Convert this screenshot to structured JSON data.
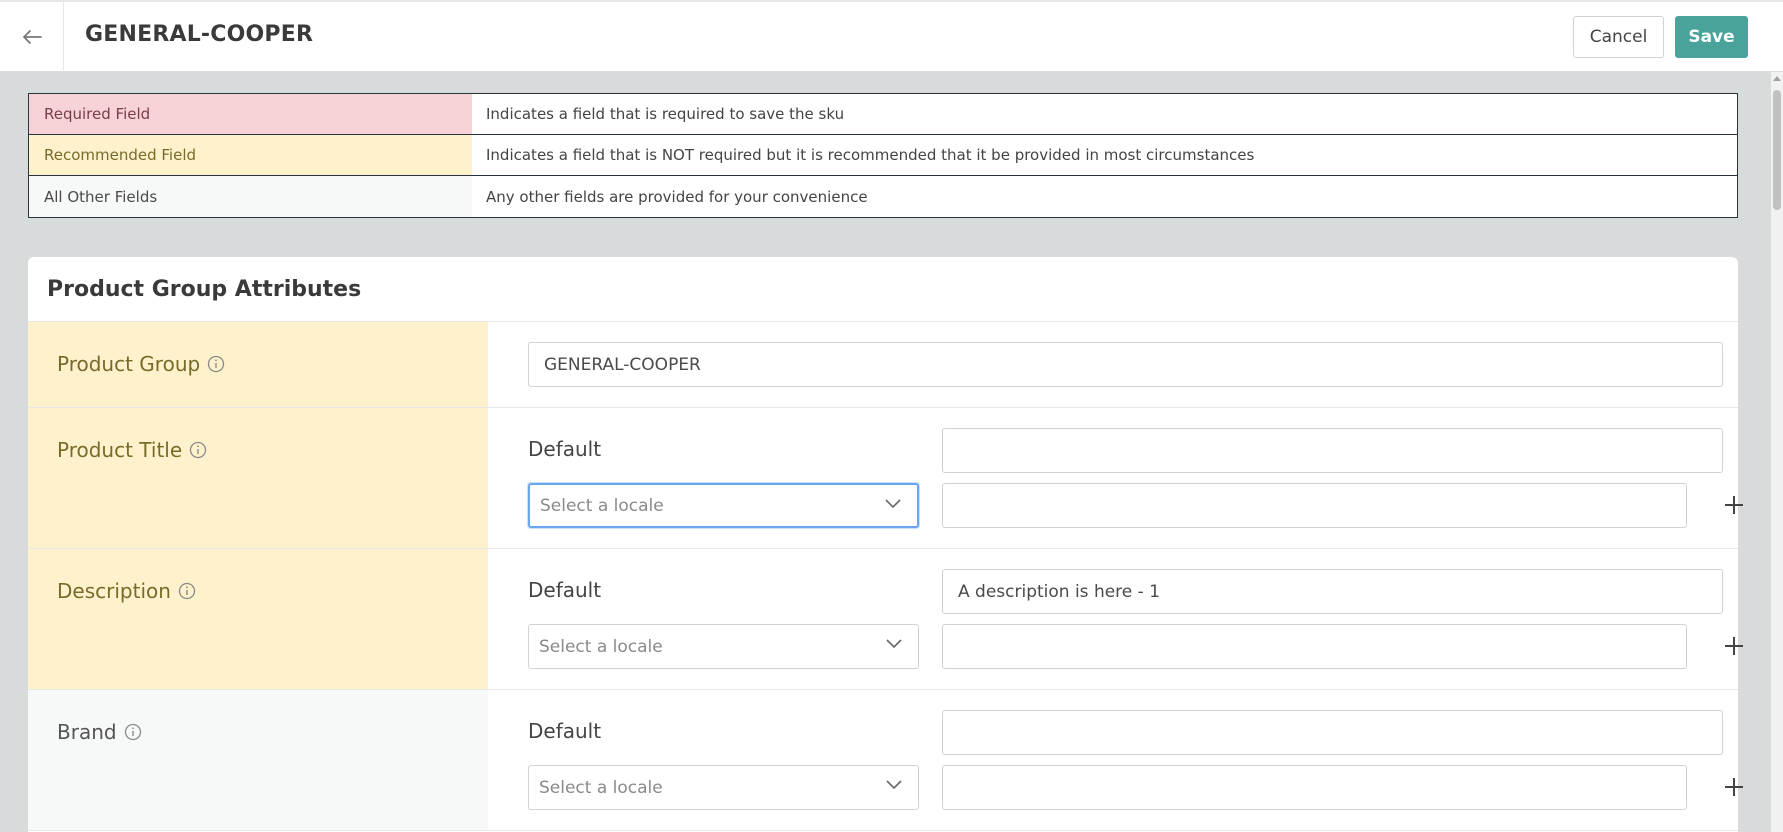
{
  "header": {
    "title": "GENERAL-COOPER",
    "cancel_label": "Cancel",
    "save_label": "Save",
    "save_color": "#4aa39a"
  },
  "legend": {
    "rows": [
      {
        "key": "Required Field",
        "description": "Indicates a field that is required to save the sku",
        "color": "#f7d3d7"
      },
      {
        "key": "Recommended Field",
        "description": "Indicates a field that is NOT required but it is recommended that it be provided in most circumstances",
        "color": "#fdf2cc"
      },
      {
        "key": "All Other Fields",
        "description": "Any other fields are provided for your convenience",
        "color": "#f7f8f8"
      }
    ]
  },
  "card": {
    "title": "Product Group Attributes",
    "fields": {
      "product_group": {
        "label": "Product Group",
        "value": "GENERAL-COOPER"
      },
      "product_title": {
        "label": "Product Title",
        "default_label": "Default",
        "default_value": "",
        "locale_placeholder": "Select a locale",
        "locale_value": ""
      },
      "description": {
        "label": "Description",
        "default_label": "Default",
        "default_value": "A description is here - 1",
        "locale_placeholder": "Select a locale",
        "locale_value": ""
      },
      "brand": {
        "label": "Brand",
        "default_label": "Default",
        "default_value": "",
        "locale_placeholder": "Select a locale",
        "locale_value": ""
      }
    }
  },
  "icons": {
    "back": "arrow-left-icon",
    "info": "info-icon",
    "chevron": "chevron-down-icon",
    "add": "plus-icon"
  }
}
